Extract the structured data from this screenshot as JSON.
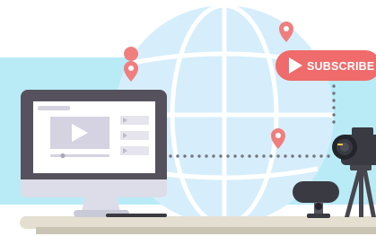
{
  "illustration": {
    "subscribe_button": {
      "label": "SUBSCRIBE",
      "icon": "play-icon"
    },
    "icons": [
      "globe-icon",
      "location-pin-icon",
      "monitor-icon",
      "video-player-icon",
      "camera-icon",
      "tripod-icon",
      "webcam-icon"
    ]
  },
  "colors": {
    "background": "#ffffff",
    "band": "#b9ebf6",
    "globe": "#d6eefb",
    "globe_lines": "#ffffff",
    "accent_red": "#f06b6b",
    "pin": "#f07e7e",
    "monitor_frame": "#55525d",
    "monitor_screen": "#ffffff",
    "monitor_stand": "#dcdde8",
    "player": "#d5d3e1",
    "desk": "#e4dfd0",
    "desk_shadow": "#c9c4b4",
    "camera_body": "#3a3a42",
    "camera_lens": "#24242b",
    "tripod": "#47464f",
    "dots": "#747480"
  }
}
